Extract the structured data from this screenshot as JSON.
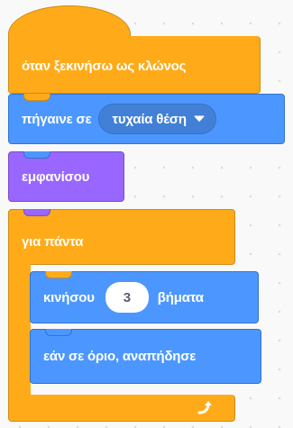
{
  "canvas": {
    "background": "#f9f9f9",
    "grid_dot_color": "#dcdcdc"
  },
  "colors": {
    "events": "#ffab19",
    "motion": "#4c97ff",
    "looks": "#9966ff",
    "control": "#ffab19",
    "input_text": "#575e75"
  },
  "script": {
    "hat": {
      "label": "όταν ξεκινήσω ως κλώνος"
    },
    "goto": {
      "label": "πήγαινε σε",
      "menu_value": "τυχαία θέση",
      "menu_icon": "dropdown-arrow-icon"
    },
    "show": {
      "label": "εμφανίσου"
    },
    "forever": {
      "label": "για πάντα",
      "loop_icon": "loop-arrow-icon",
      "body": {
        "move": {
          "label_before": "κινήσου",
          "steps_value": "3",
          "label_after": "βήματα"
        },
        "bounce": {
          "label": "εάν σε όριο, αναπήδησε"
        }
      }
    }
  }
}
